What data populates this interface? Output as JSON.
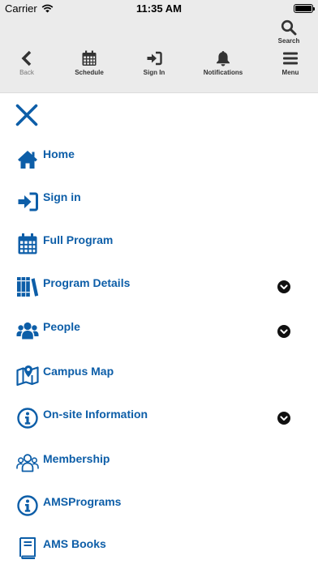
{
  "status_bar": {
    "carrier": "Carrier",
    "time": "11:35 AM",
    "battery_level": 1.0
  },
  "toolbar": {
    "search_label": "Search",
    "back_label": "Back",
    "schedule_label": "Schedule",
    "signin_label": "Sign In",
    "notifications_label": "Notifications",
    "menu_label": "Menu"
  },
  "menu": {
    "close_icon": "close-icon",
    "items": [
      {
        "label": "Home",
        "icon": "home-icon",
        "expandable": false
      },
      {
        "label": "Sign in",
        "icon": "sign-in-icon",
        "expandable": false
      },
      {
        "label": "Full Program",
        "icon": "calendar-icon",
        "expandable": false
      },
      {
        "label": "Program Details",
        "icon": "books-icon",
        "expandable": true
      },
      {
        "label": "People",
        "icon": "users-icon",
        "expandable": true
      },
      {
        "label": "Campus Map",
        "icon": "map-icon",
        "expandable": false
      },
      {
        "label": "On-site Information",
        "icon": "info-icon",
        "expandable": true
      },
      {
        "label": "Membership",
        "icon": "users-outline-icon",
        "expandable": false
      },
      {
        "label": "AMSPrograms",
        "icon": "info-icon",
        "expandable": false
      },
      {
        "label": "AMS Books",
        "icon": "book-icon",
        "expandable": false
      }
    ]
  },
  "colors": {
    "accent": "#0d5ea8",
    "toolbar_bg": "#ebebeb",
    "chevron": "#111111"
  }
}
